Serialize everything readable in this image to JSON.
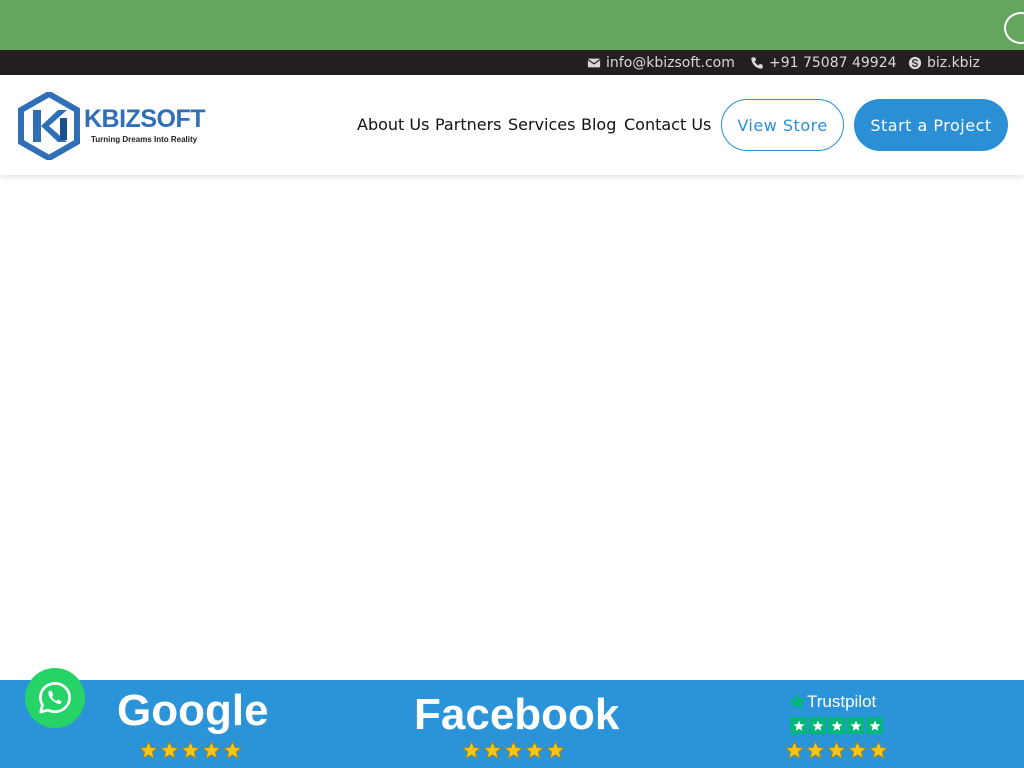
{
  "topbar": {
    "email": "info@kbizsoft.com",
    "phone": "+91 75087 49924",
    "skype": "biz.kbiz"
  },
  "logo": {
    "name": "KBIZSOFT",
    "tagline": "Turning Dreams Into Reality"
  },
  "nav": {
    "items": [
      "About Us",
      "Partners",
      "Services",
      "Blog",
      "Contact Us"
    ]
  },
  "buttons": {
    "view_store": "View Store",
    "start_project": "Start a Project"
  },
  "reviews": {
    "google": {
      "name": "Google",
      "rating": 5
    },
    "facebook": {
      "name": "Facebook",
      "rating": 5
    },
    "trustpilot": {
      "name": "Trustpilot",
      "rating": 5
    }
  },
  "colors": {
    "promo_green": "#64a560",
    "topbar_dark": "#231f20",
    "brand_blue": "#2b8fd6",
    "star_gold": "#f5c518",
    "trustpilot_green": "#00b67a",
    "whatsapp_green": "#25d366"
  },
  "icons": {
    "email": "envelope-icon",
    "phone": "phone-icon",
    "skype": "skype-icon",
    "whatsapp": "whatsapp-icon",
    "star": "star-icon"
  }
}
